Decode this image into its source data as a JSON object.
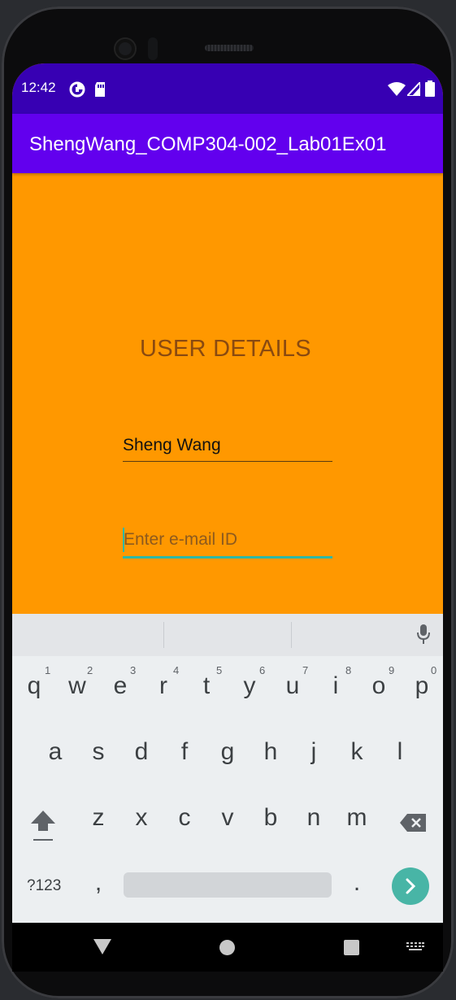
{
  "status_bar": {
    "time": "12:42",
    "icons": [
      "data-saver-icon",
      "sd-card-icon",
      "wifi-icon",
      "cell-signal-icon",
      "battery-icon"
    ]
  },
  "app_bar": {
    "title": "ShengWang_COMP304-002_Lab01Ex01"
  },
  "form": {
    "heading": "USER DETAILS",
    "name_value": "Sheng Wang",
    "email_placeholder": "Enter e-mail ID"
  },
  "keyboard": {
    "row1": [
      "q",
      "w",
      "e",
      "r",
      "t",
      "y",
      "u",
      "i",
      "o",
      "p"
    ],
    "row1_hints": [
      "1",
      "2",
      "3",
      "4",
      "5",
      "6",
      "7",
      "8",
      "9",
      "0"
    ],
    "row2": [
      "a",
      "s",
      "d",
      "f",
      "g",
      "h",
      "j",
      "k",
      "l"
    ],
    "row3": [
      "z",
      "x",
      "c",
      "v",
      "b",
      "n",
      "m"
    ],
    "symbols_label": "?123",
    "comma": ",",
    "period": "."
  },
  "colors": {
    "status_bar": "#3700b3",
    "app_bar": "#6200ee",
    "background": "#ff9800",
    "accent": "#2fb8a6"
  }
}
